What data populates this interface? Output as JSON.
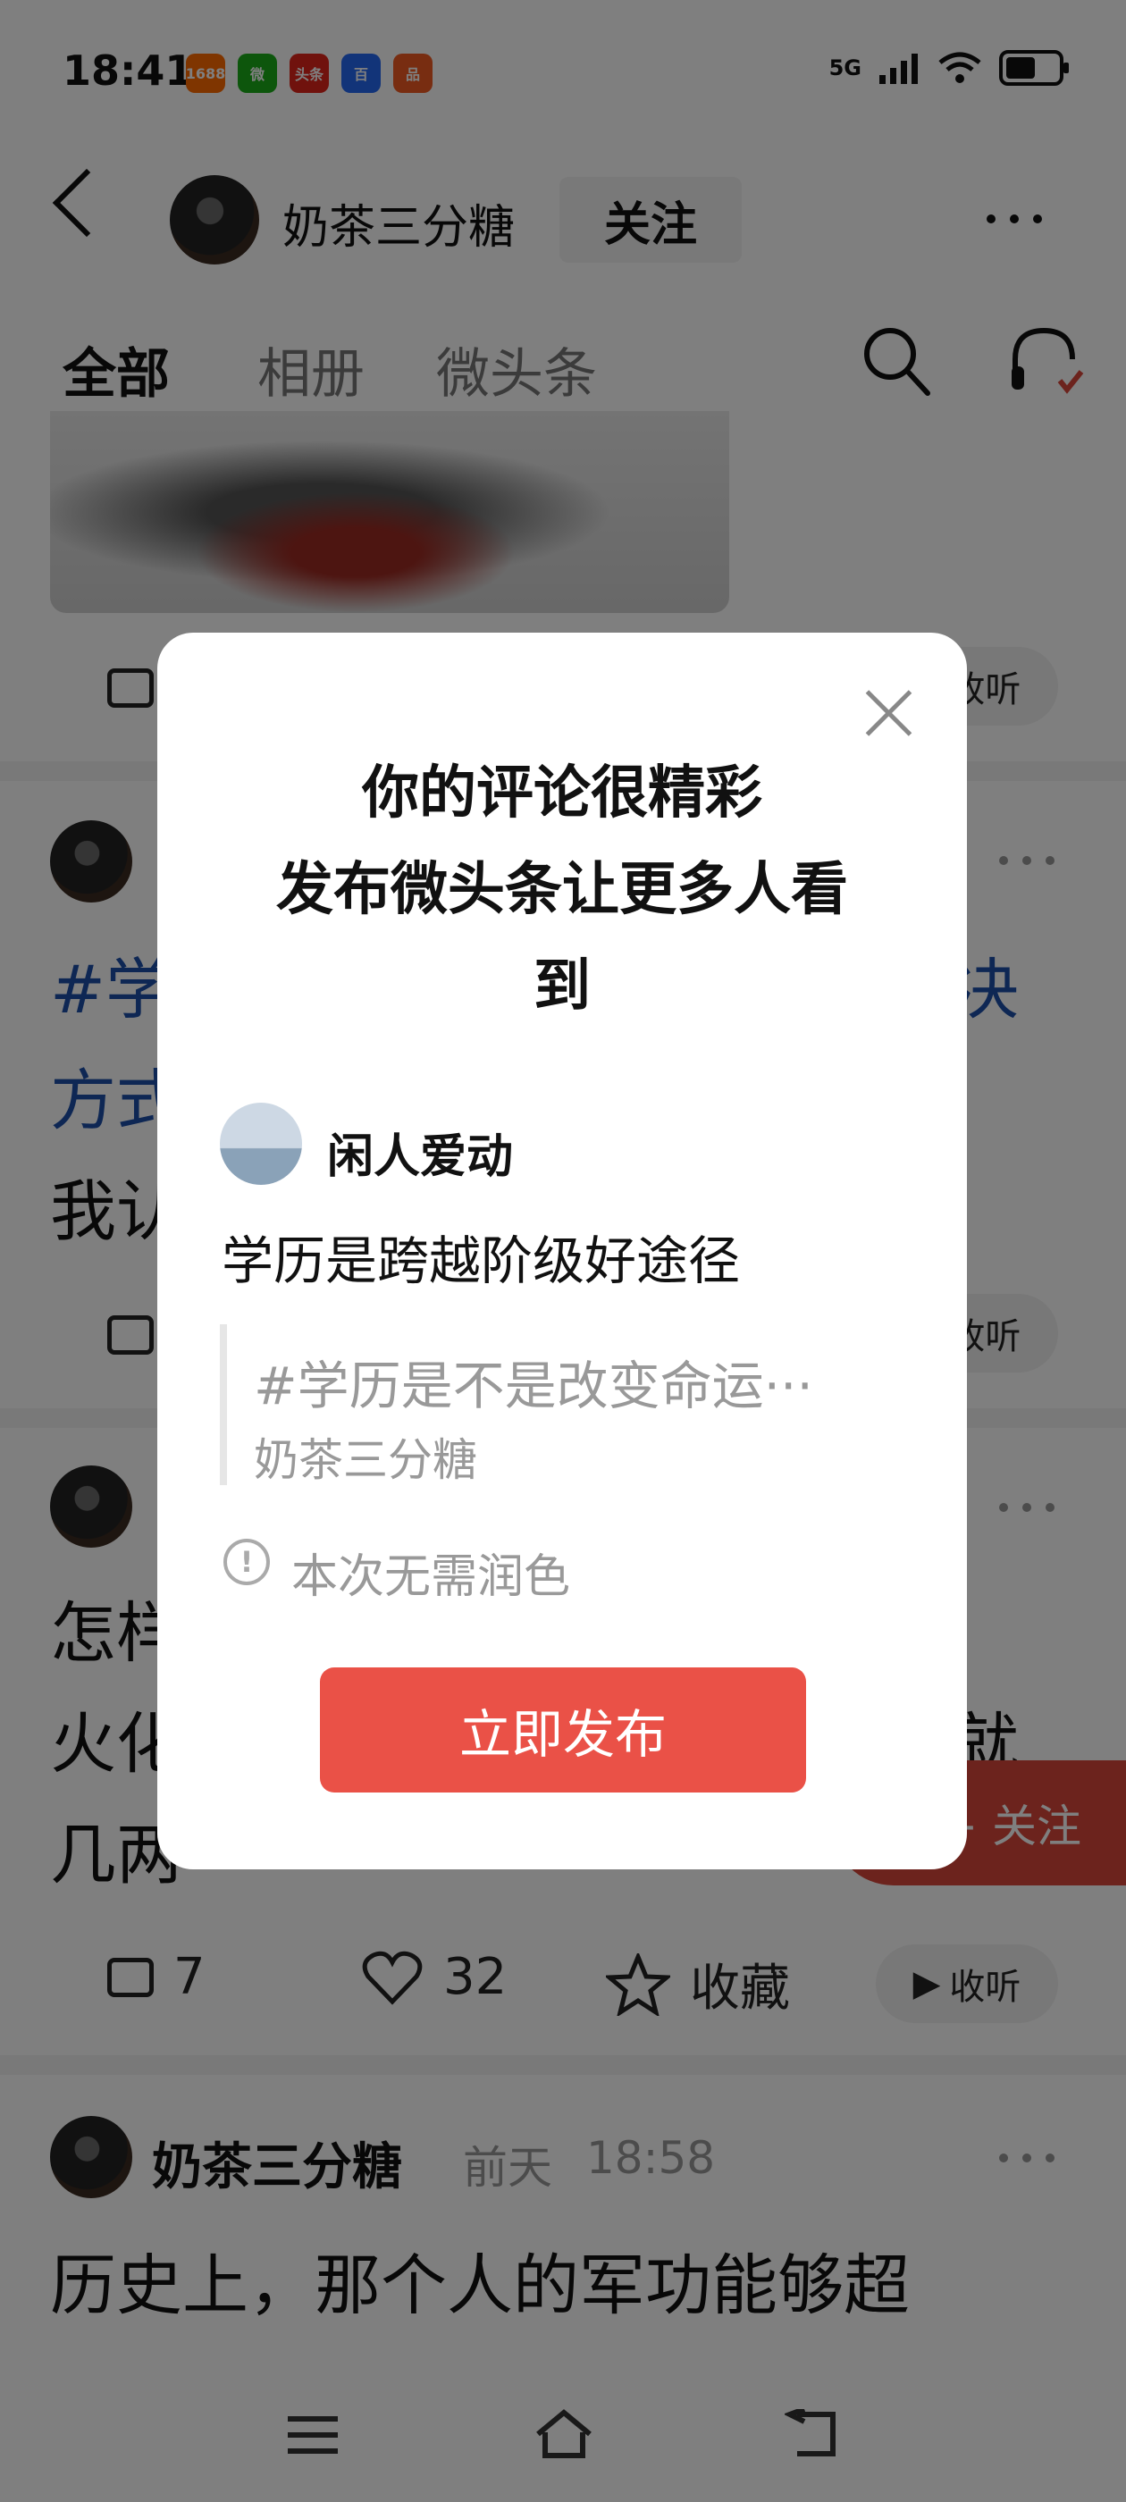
{
  "status_bar": {
    "time": "18:41",
    "app_icons": [
      {
        "label": "1688",
        "color": "#ff6a00",
        "icon": "alibaba-1688-icon"
      },
      {
        "label": "微",
        "color": "#1aad19",
        "icon": "wechat-icon"
      },
      {
        "label": "头条",
        "color": "#e1251b",
        "icon": "toutiao-icon"
      },
      {
        "label": "百",
        "color": "#2468f2",
        "icon": "baidu-icon"
      },
      {
        "label": "品",
        "color": "#f05a22",
        "icon": "app-icon"
      }
    ],
    "network": "5G"
  },
  "header": {
    "author": "奶茶三分糖",
    "follow_label": "关注"
  },
  "tabs": [
    {
      "label": "全部",
      "active": true
    },
    {
      "label": "相册",
      "active": false
    },
    {
      "label": "微头条",
      "active": false
    }
  ],
  "feed": {
    "listen_label": "收听",
    "post2": {
      "text_line1": "#学",
      "text_line1_end": "决",
      "text_line2": "方式",
      "text_line3": "我认"
    },
    "post3": {
      "text_line1": "怎样",
      "text_line2": "火化",
      "text_line2_end": "就",
      "text_line3": "几两",
      "comments": "7",
      "likes": "32",
      "favorite_label": "收藏"
    },
    "post4": {
      "author": "奶茶三分糖",
      "date": "前天",
      "time": "18:58",
      "text": "历史上，那个人的军功能够超"
    },
    "float_follow_label": "+ 关注"
  },
  "modal": {
    "title_line1": "你的评论很精彩",
    "title_line2": "发布微头条让更多人看",
    "title_line3": "到",
    "commenter": "闲人爱动",
    "comment": "学历是跨越阶级好途径",
    "quote_title": "#学历是不是改变命运···",
    "quote_author": "奶茶三分糖",
    "info_text": "本次无需润色",
    "publish_label": "立即发布"
  },
  "colors": {
    "accent_red": "#ea5147",
    "link_blue": "#1c4fa8"
  }
}
